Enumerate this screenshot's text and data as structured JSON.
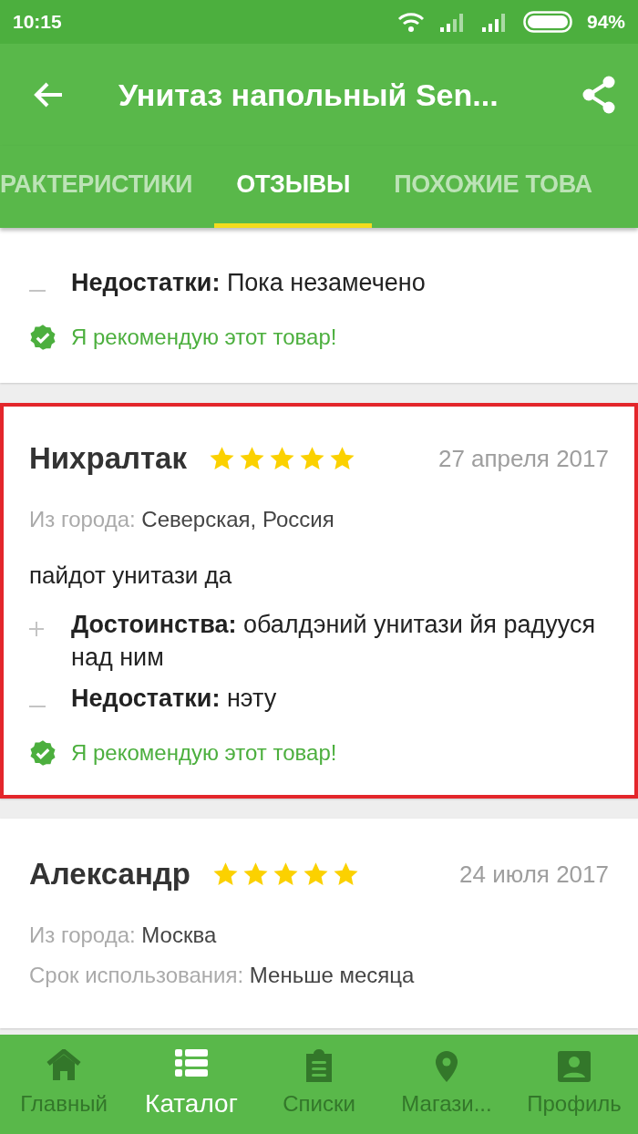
{
  "status_bar": {
    "time": "10:15",
    "battery": "94%"
  },
  "app_bar": {
    "title": "Унитаз напольный Sen..."
  },
  "tabs": [
    {
      "label": "РАКТЕРИСТИКИ",
      "selected": false
    },
    {
      "label": "ОТЗЫВЫ",
      "selected": true
    },
    {
      "label": "ПОХОЖИЕ ТОВА",
      "selected": false
    }
  ],
  "reviews": [
    {
      "highlighted": false,
      "cons_label": "Недостатки:",
      "cons": "Пока незамечено",
      "recommend": "Я рекомендую этот товар!"
    },
    {
      "highlighted": true,
      "author": "Нихралтак",
      "stars": 5,
      "date": "27 апреля 2017",
      "city_label": "Из города:",
      "city": "Северская, Россия",
      "text": "пайдот унитази да",
      "pros_label": "Достоинства:",
      "pros": "обалдэний унитази йя радууся над ним",
      "cons_label": "Недостатки:",
      "cons": "нэту",
      "recommend": "Я рекомендую этот товар!"
    },
    {
      "highlighted": false,
      "author": "Александр",
      "stars": 5,
      "date": "24 июля 2017",
      "city_label": "Из города:",
      "city": "Москва",
      "usage_label": "Срок использования:",
      "usage": "Меньше месяца"
    }
  ],
  "bottom_nav": [
    {
      "label": "Главный",
      "kind": "home",
      "selected": false
    },
    {
      "label": "Каталог",
      "kind": "catalog",
      "selected": true
    },
    {
      "label": "Списки",
      "kind": "lists",
      "selected": false
    },
    {
      "label": "Магази...",
      "kind": "shops",
      "selected": false
    },
    {
      "label": "Профиль",
      "kind": "profile",
      "selected": false
    }
  ]
}
